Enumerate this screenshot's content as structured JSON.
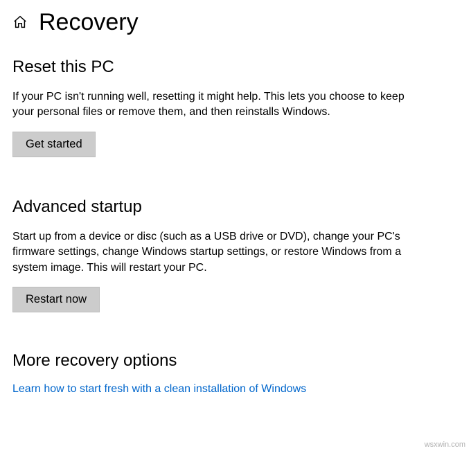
{
  "header": {
    "title": "Recovery"
  },
  "sections": {
    "reset": {
      "heading": "Reset this PC",
      "desc": "If your PC isn't running well, resetting it might help. This lets you choose to keep your personal files or remove them, and then reinstalls Windows.",
      "button": "Get started"
    },
    "advanced": {
      "heading": "Advanced startup",
      "desc": "Start up from a device or disc (such as a USB drive or DVD), change your PC's firmware settings, change Windows startup settings, or restore Windows from a system image. This will restart your PC.",
      "button": "Restart now"
    },
    "more": {
      "heading": "More recovery options",
      "link": "Learn how to start fresh with a clean installation of Windows"
    }
  },
  "attribution": "wsxwin.com"
}
